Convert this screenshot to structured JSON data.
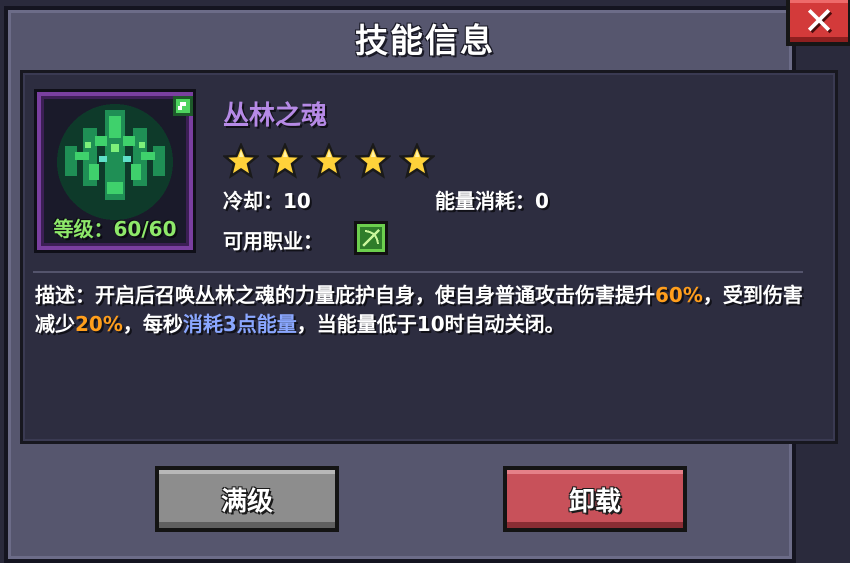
{
  "dialog": {
    "title": "技能信息",
    "close_label": "✕"
  },
  "skill": {
    "name": "丛林之魂",
    "stars": 5,
    "level_label": "等级：60/60",
    "cooldown_label": "冷却：10",
    "energy_label": "能量消耗：0",
    "class_label": "可用职业：",
    "class_icon": "bow-icon",
    "skill_icon": "jungle-soul-icon"
  },
  "description": {
    "prefix": "描述：开启后召唤丛林之魂的力量庇护自身，使自身普通攻击伤害提升",
    "value1": "60%",
    "text2": "，受到伤害减少",
    "value2": "20%",
    "text3": "，每秒",
    "highlight": "消耗3点能量",
    "text4": "，当能量低于10时自动关闭。"
  },
  "buttons": {
    "max_label": "满级",
    "unload_label": "卸载"
  },
  "colors": {
    "panel": "#56566e",
    "content": "#2d2d40",
    "skill_name": "#b68ae6",
    "level": "#8ee86a",
    "highlight_orange": "#ff9e1c",
    "highlight_blue": "#8aa7ff",
    "button_gray": "#8d8d8d",
    "button_red": "#c8515a",
    "close_red": "#d33a3a"
  }
}
